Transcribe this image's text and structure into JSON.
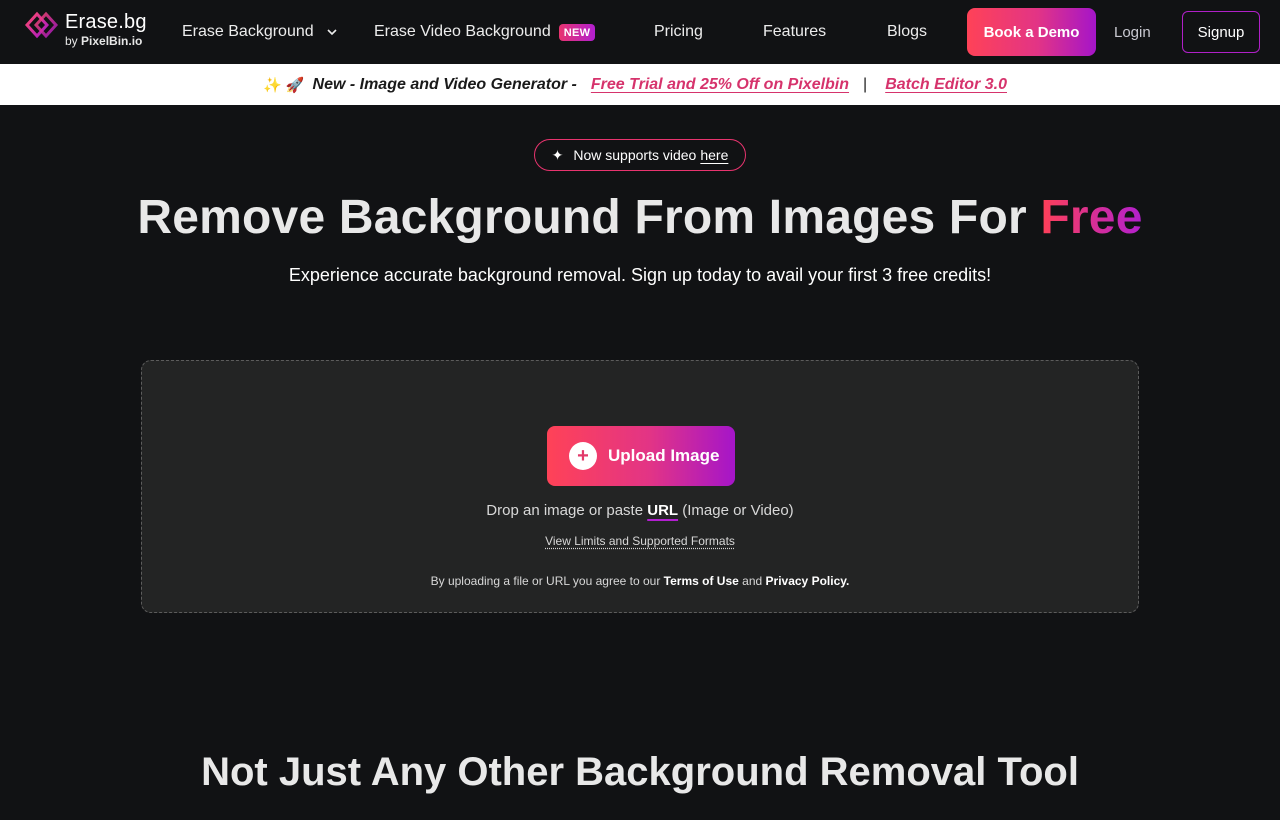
{
  "nav": {
    "logo_title": "Erase.bg",
    "logo_by": "by",
    "logo_brand": "PixelBin.io",
    "items": [
      {
        "label": "Erase Background"
      },
      {
        "label": "Erase Video Background",
        "badge": "NEW"
      },
      {
        "label": "Pricing"
      },
      {
        "label": "Features"
      },
      {
        "label": "Blogs"
      }
    ],
    "demo_label": "Book a Demo",
    "login_label": "Login",
    "signup_label": "Signup"
  },
  "announce": {
    "emojis": "✨ 🚀",
    "text": "New - Image and Video Generator -",
    "link1": "Free Trial and 25% Off on Pixelbin",
    "separator": "|",
    "link2": "Batch Editor 3.0"
  },
  "hero": {
    "pill_text": "Now supports video",
    "pill_link": "here",
    "title_main": "Remove Background From Images For ",
    "title_highlight": "Free",
    "subtitle": "Experience accurate background removal. Sign up today to avail your first 3 free credits!"
  },
  "upload": {
    "button_label": "Upload Image",
    "drop_prefix": "Drop an image or paste",
    "drop_url": "URL",
    "drop_suffix": "(Image or Video)",
    "limits_link": "View Limits and Supported Formats",
    "terms_prefix": "By uploading a file or URL you agree to our",
    "terms_link": "Terms of Use",
    "terms_and": "and",
    "privacy_link": "Privacy Policy."
  },
  "section": {
    "title": "Not Just Any Other Background Removal Tool"
  },
  "colors": {
    "accent_start": "#ff4257",
    "accent_mid": "#e23486",
    "accent_end": "#a515c9",
    "background": "#111214",
    "upload_box": "#232424"
  }
}
